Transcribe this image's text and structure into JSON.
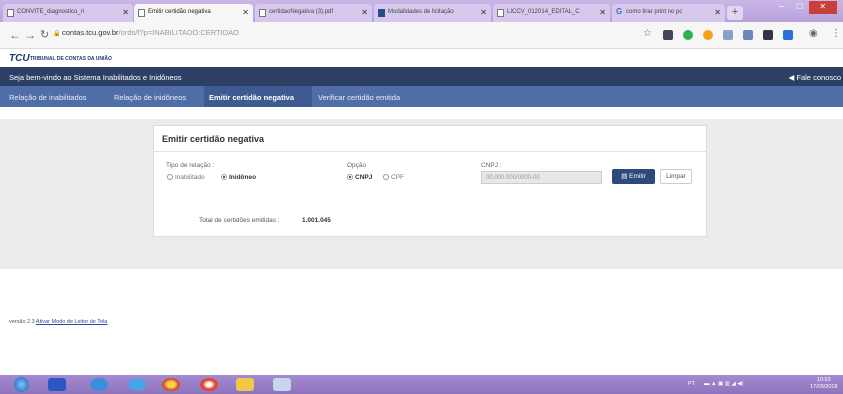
{
  "browser": {
    "tabs": [
      {
        "label": "CONVITE_diagnostico_ri",
        "active": false
      },
      {
        "label": "Emitir certidão negativa",
        "active": true
      },
      {
        "label": "certidaoNegativa (3).pdf",
        "active": false
      },
      {
        "label": "Modalidades de licitação",
        "active": false
      },
      {
        "label": "LICCV_012014_EDITAL_C",
        "active": false
      },
      {
        "label": "como tirar print no pc",
        "active": false
      }
    ],
    "url_host": "contas.tcu.gov.br",
    "url_path": "/ords/f?p=INABILITADO:CERTIDAO"
  },
  "site": {
    "logo": "TCU",
    "org_name": "TRIBUNAL DE CONTAS DA UNIÃO",
    "welcome": "Seja bem-vindo ao Sistema Inabilitados e Inidôneos",
    "contact": "Fale conosco"
  },
  "menu": [
    {
      "label": "Relação de inabilitados"
    },
    {
      "label": "Relação de inidôneos"
    },
    {
      "label": "Emitir certidão negativa"
    },
    {
      "label": "Verificar certidão emitida"
    }
  ],
  "form": {
    "title": "Emitir certidão negativa",
    "relation_label": "Tipo de relação :",
    "relation_options": [
      "Inabilitado",
      "Inidôneo"
    ],
    "relation_selected": "Inidôneo",
    "option_label": "Opção",
    "option_choices": [
      "CNPJ",
      "CPF"
    ],
    "option_selected": "CNPJ",
    "cnpj_label": "CNPJ :",
    "cnpj_placeholder": "00.000.000/0000-00",
    "emitir_label": "Emitir",
    "limpar_label": "Limpar",
    "total_label": "Total de certidões emitidas :",
    "total_value": "1.001.045"
  },
  "footer": {
    "version": "versão 2.3",
    "link": "Ativar Modo de Leitor de Tela"
  },
  "taskbar": {
    "lang": "PT",
    "time": "10:53",
    "date": "17/09/2018"
  }
}
